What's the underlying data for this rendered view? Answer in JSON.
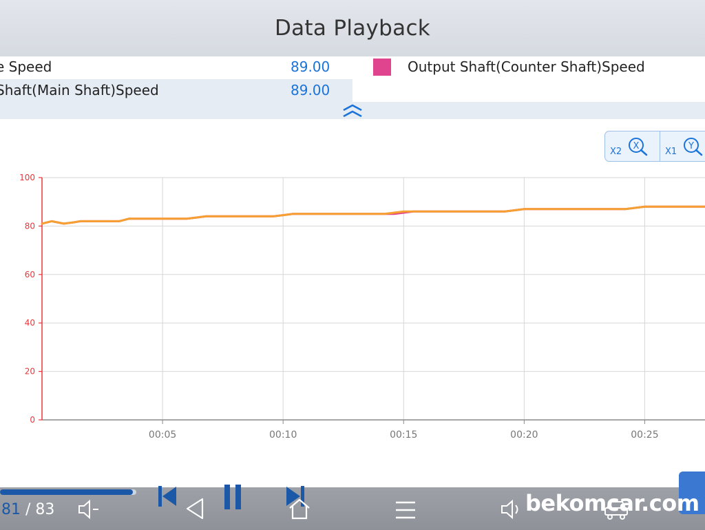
{
  "window": {
    "title": "Data Playback"
  },
  "legend": {
    "rows": [
      {
        "label": "e Speed",
        "value": "89.00"
      },
      {
        "label": "Shaft(Main Shaft)Speed",
        "value": "89.00"
      }
    ],
    "series_item": {
      "label": "Output Shaft(Counter Shaft)Speed",
      "swatch_color": "#e0448e"
    },
    "collapse_icon": "double-chevron-up-icon"
  },
  "zoom": {
    "x": {
      "multiplier": "X2",
      "letter": "X"
    },
    "y": {
      "multiplier": "X1",
      "letter": "Y"
    }
  },
  "playback": {
    "current": "81",
    "separator": "/",
    "total": "83",
    "progress_fraction": 0.976,
    "icons": [
      "volume-down-icon",
      "skip-previous-icon",
      "back-icon",
      "pause-icon",
      "skip-next-icon",
      "home-icon",
      "menu-icon",
      "volume-icon",
      "car-icon"
    ]
  },
  "watermark": "bekomcar.com",
  "colors": {
    "accent": "#1a73d9",
    "series_orange": "#f5a030",
    "series_pink": "#e0448e",
    "axis_red": "#e8353a"
  },
  "chart_data": {
    "type": "line",
    "title": "",
    "xlabel": "",
    "ylabel": "",
    "ylim": [
      0,
      100
    ],
    "xlim": [
      0,
      27.5
    ],
    "yticks": [
      "0",
      "20",
      "40",
      "60",
      "80",
      "100"
    ],
    "xticks": [
      {
        "t": 5,
        "label": "00:05"
      },
      {
        "t": 10,
        "label": "00:10"
      },
      {
        "t": 15,
        "label": "00:15"
      },
      {
        "t": 20,
        "label": "00:20"
      },
      {
        "t": 25,
        "label": "00:25"
      }
    ],
    "grid": true,
    "series": [
      {
        "color": "#e0448e",
        "x": [
          0,
          0.4,
          0.9,
          1.3,
          1.6,
          2.0,
          3.2,
          3.6,
          4.0,
          6.0,
          6.4,
          6.8,
          9.6,
          10.0,
          10.4,
          14.2,
          14.6,
          15.0,
          15.4,
          19.2,
          19.6,
          20.0,
          24.2,
          24.6,
          25.0,
          27.5
        ],
        "y": [
          81,
          82,
          81,
          81.5,
          82,
          82,
          82,
          83,
          83,
          83,
          83.5,
          84,
          84,
          84.5,
          85,
          85,
          85,
          85.5,
          86,
          86,
          86.5,
          87,
          87,
          87.5,
          88,
          88
        ]
      },
      {
        "color": "#f5a030",
        "x": [
          0,
          0.4,
          0.9,
          1.3,
          1.6,
          2.0,
          3.2,
          3.6,
          4.0,
          6.0,
          6.4,
          6.8,
          9.6,
          10.0,
          10.4,
          14.2,
          14.6,
          15.0,
          15.4,
          19.2,
          19.6,
          20.0,
          24.2,
          24.6,
          25.0,
          27.5
        ],
        "y": [
          81,
          82,
          81,
          81.5,
          82,
          82,
          82,
          83,
          83,
          83,
          83.5,
          84,
          84,
          84.5,
          85,
          85,
          85.5,
          86,
          86,
          86,
          86.5,
          87,
          87,
          87.5,
          88,
          88
        ]
      }
    ]
  }
}
